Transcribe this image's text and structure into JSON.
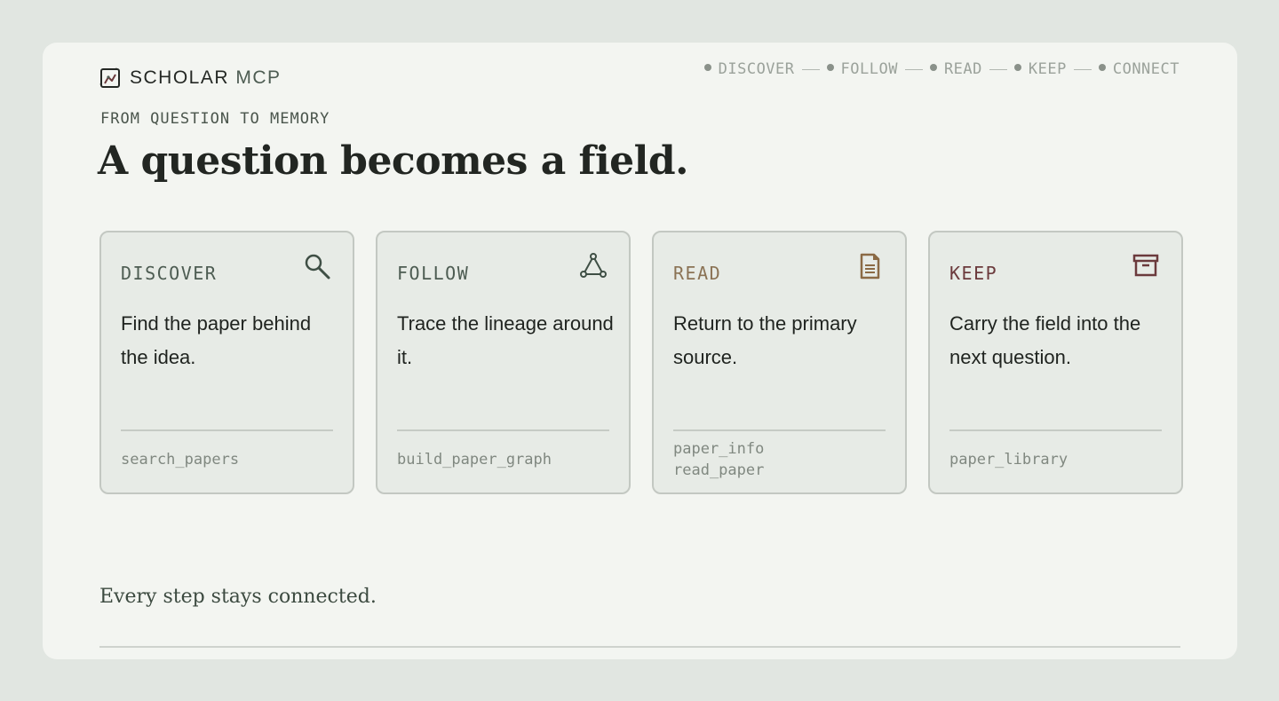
{
  "brand": {
    "name": "SCHOLAR",
    "accent": "MCP",
    "logo_icon": "chart-logo-icon"
  },
  "stepper": [
    {
      "label": "DISCOVER"
    },
    {
      "label": "FOLLOW"
    },
    {
      "label": "READ"
    },
    {
      "label": "KEEP"
    },
    {
      "label": "CONNECT"
    }
  ],
  "eyebrow": "FROM QUESTION TO MEMORY",
  "title": "A question becomes a field.",
  "cards": [
    {
      "label": "DISCOVER",
      "label_color": "#4d5c52",
      "icon": "search-icon",
      "description": "Find the paper behind the idea.",
      "tools": [
        "search_papers"
      ]
    },
    {
      "label": "FOLLOW",
      "label_color": "#4d5c52",
      "icon": "graph-icon",
      "description": "Trace the lineage around it.",
      "tools": [
        "build_paper_graph"
      ]
    },
    {
      "label": "READ",
      "label_color": "#8b7355",
      "icon": "document-icon",
      "description": "Return to the primary source.",
      "tools": [
        "paper_info",
        "read_paper"
      ]
    },
    {
      "label": "KEEP",
      "label_color": "#6b3a3c",
      "icon": "archive-icon",
      "description": "Carry the field into the next question.",
      "tools": [
        "paper_library"
      ]
    }
  ],
  "footer": "Every step stays connected.",
  "colors": {
    "background": "#e1e6e1",
    "panel": "#f3f5f1",
    "card": "#e7ebe6",
    "green_accent": "#4d5c52",
    "brown_accent": "#8b7355",
    "maroon_accent": "#6b3a3c"
  }
}
